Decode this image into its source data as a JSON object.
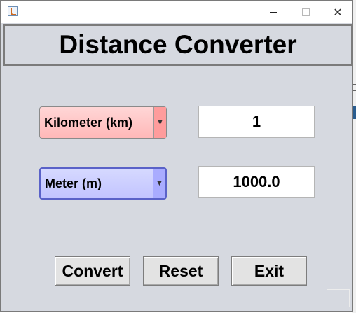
{
  "window": {
    "close_glyph": "✕"
  },
  "header": {
    "title": "Distance Converter"
  },
  "from_unit": {
    "selected": "Kilometer (km)",
    "color": "#ffb8b8"
  },
  "to_unit": {
    "selected": "Meter (m)",
    "color": "#c2c4ff"
  },
  "input_value": "1",
  "output_value": "1000.0",
  "buttons": {
    "convert": "Convert",
    "reset": "Reset",
    "exit": "Exit"
  },
  "icons": {
    "dropdown_arrow": "▼"
  }
}
